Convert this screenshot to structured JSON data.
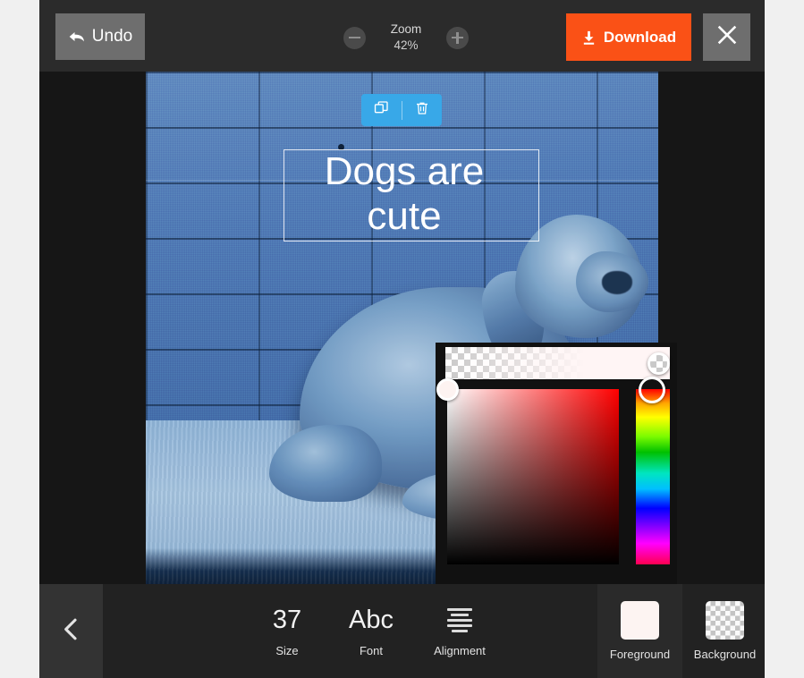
{
  "app": {
    "name": "photo-editor",
    "accent_orange": "#fa5116",
    "accent_blue": "#38a8e8",
    "toolbar_bg": "#2b2b2b",
    "canvas_bg": "#161616",
    "page_bg": "#f0f0f0"
  },
  "topbar": {
    "undo_label": "Undo",
    "zoom_label": "Zoom",
    "zoom_value": "42%",
    "zoom_out_icon": "minus-circle-icon",
    "zoom_in_icon": "plus-circle-icon",
    "download_label": "Download",
    "download_icon": "download-icon",
    "close_icon": "close-icon"
  },
  "canvas": {
    "image_alt": "blue-tinted photo of a weimaraner dog lying on concrete in front of a cinder block wall",
    "text_layer": {
      "content": "Dogs are\ncute",
      "color": "#ffffff",
      "selected": true
    },
    "object_toolbar": {
      "duplicate_icon": "duplicate-icon",
      "delete_icon": "trash-icon"
    }
  },
  "color_picker": {
    "visible": true,
    "alpha_slider_name": "alpha-slider",
    "saturation_square_name": "saturation-value-square",
    "hue_slider_name": "hue-slider",
    "selected_hue": "#ff0000",
    "selected_color": "#ffffff"
  },
  "bottombar": {
    "back_icon": "chevron-left-icon",
    "tools": [
      {
        "glyph": "37",
        "label": "Size",
        "name": "size"
      },
      {
        "glyph": "Abc",
        "label": "Font",
        "name": "font"
      },
      {
        "glyph": "",
        "label": "Alignment",
        "name": "alignment"
      }
    ],
    "swatches": [
      {
        "label": "Foreground",
        "name": "foreground",
        "color": "#fdf4f2",
        "transparent": false,
        "selected": true
      },
      {
        "label": "Background",
        "name": "background",
        "color": "transparent",
        "transparent": true,
        "selected": false
      }
    ]
  }
}
